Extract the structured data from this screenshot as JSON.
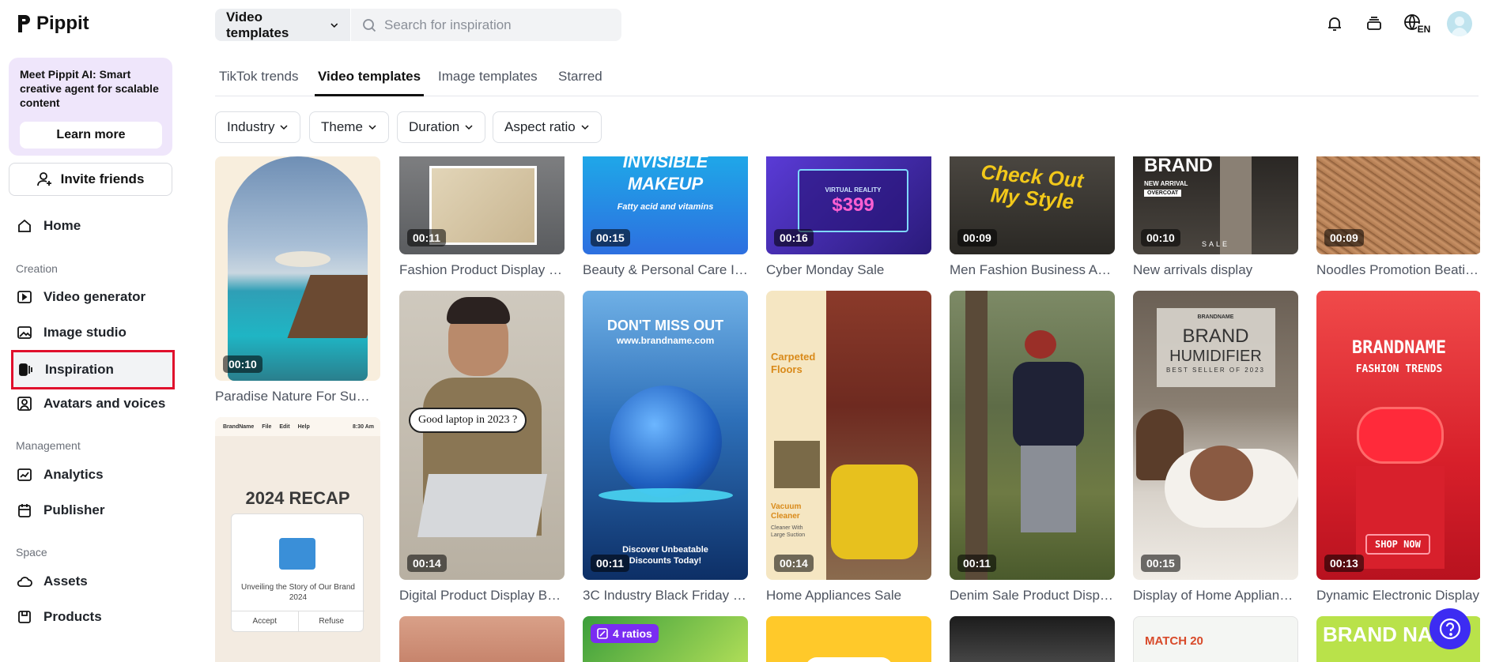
{
  "app": {
    "name": "Pippit"
  },
  "promo": {
    "text": "Meet Pippit AI: Smart creative agent for scalable content",
    "button": "Learn more"
  },
  "invite": {
    "label": "Invite friends"
  },
  "nav": {
    "home": "Home",
    "creation_label": "Creation",
    "video_generator": "Video generator",
    "image_studio": "Image studio",
    "inspiration": "Inspiration",
    "avatars": "Avatars and voices",
    "management_label": "Management",
    "analytics": "Analytics",
    "publisher": "Publisher",
    "space_label": "Space",
    "assets": "Assets",
    "products": "Products"
  },
  "header": {
    "type_select": "Video templates",
    "search_placeholder": "Search for inspiration",
    "lang": "EN"
  },
  "tabs": [
    "TikTok trends",
    "Video templates",
    "Image templates",
    "Starred"
  ],
  "filters": [
    "Industry",
    "Theme",
    "Duration",
    "Aspect ratio"
  ],
  "cards": {
    "c1": {
      "title": "Paradise Nature For Summ...",
      "duration": "00:10"
    },
    "c2": {
      "title": "Fashion Product Display Cr...",
      "duration": "00:11"
    },
    "c3": {
      "title": "Beauty & Personal Care In...",
      "duration": "00:15",
      "overlay1": "INVISIBLE",
      "overlay2": "MAKEUP",
      "overlay3": "Fatty acid and vitamins"
    },
    "c4": {
      "title": "Cyber Monday Sale",
      "duration": "00:16",
      "overlay1": "VIRTUAL REALITY",
      "overlay2": "$399"
    },
    "c5": {
      "title": "Men Fashion Business Ads ...",
      "duration": "00:09",
      "overlay1": "Check Out",
      "overlay2": "My Style"
    },
    "c6": {
      "title": "New arrivals display",
      "duration": "00:10",
      "overlay1": "BRAND",
      "overlay2": "NEW ARRIVAL",
      "overlay3": "OVERCOAT",
      "overlay4": "SALE"
    },
    "c7": {
      "title": "Noodles Promotion Beatin...",
      "duration": "00:09"
    },
    "c8": {
      "title": "Digital Product Display Bea...",
      "duration": "00:14",
      "overlay1": "Good laptop in 2023 ?"
    },
    "c9": {
      "title": "3C Industry Black Friday S...",
      "duration": "00:11",
      "overlay1": "DON'T MISS OUT",
      "overlay2": "www.brandname.com",
      "overlay3": "Discover Unbeatable",
      "overlay4": "Discounts Today!"
    },
    "c10": {
      "title": "Home Appliances Sale",
      "duration": "00:14",
      "overlay1": "Carpeted",
      "overlay2": "Floors",
      "overlay3": "Vacuum",
      "overlay4": "Cleaner",
      "overlay5": "Cleaner With Large Suction"
    },
    "c11": {
      "title": "Denim Sale Product Display",
      "duration": "00:11"
    },
    "c12": {
      "title": "Display of Home Appliance...",
      "duration": "00:15",
      "overlay1": "BRANDNAME",
      "overlay2": "BRAND",
      "overlay3": "HUMIDIFIER",
      "overlay4": "BEST SELLER OF 2023"
    },
    "c13": {
      "title": "Dynamic Electronic Display",
      "duration": "00:13",
      "overlay1": "BRANDNAME",
      "overlay2": "FASHION TRENDS",
      "overlay3": "SHOP NOW"
    },
    "c14": {
      "overlay1": "BrandName",
      "overlay2": "File",
      "overlay3": "Edit",
      "overlay4": "Help",
      "overlay5": "8:30 Am",
      "overlay6": "2024 RECAP",
      "overlay7": "Unveiling the Story of Our Brand 2024",
      "overlay8": "Accept",
      "overlay9": "Refuse"
    },
    "c16": {
      "ratio": "4 ratios"
    },
    "c19": {
      "overlay1": "MATCH 20"
    },
    "c20": {
      "overlay1": "BRAND NA"
    }
  }
}
